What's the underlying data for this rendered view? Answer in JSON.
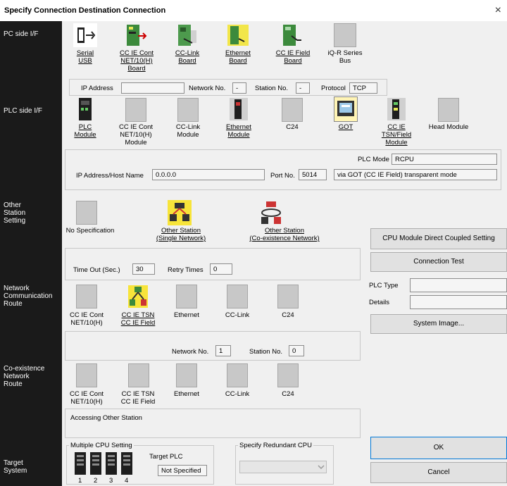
{
  "window": {
    "title": "Specify Connection Destination Connection",
    "close_glyph": "×"
  },
  "left_labels": {
    "pc_side": "PC side I/F",
    "plc_side": "PLC side I/F",
    "other_station": "Other\nStation\nSetting",
    "network_route": "Network\nCommunication\nRoute",
    "coexistence_route": "Co-existence\nNetwork\nRoute",
    "target_system": "Target\nSystem"
  },
  "pc_side": {
    "tiles": [
      {
        "label": "Serial\nUSB",
        "icon": "serial-usb-icon"
      },
      {
        "label": "CC IE Cont\nNET/10(H)\nBoard",
        "icon": "cc-ie-cont-board-icon"
      },
      {
        "label": "CC-Link\nBoard",
        "icon": "cc-link-board-icon"
      },
      {
        "label": "Ethernet\nBoard",
        "icon": "ethernet-board-icon"
      },
      {
        "label": "CC IE Field\nBoard",
        "icon": "cc-ie-field-board-icon"
      },
      {
        "label": "iQ-R Series\nBus",
        "icon": "iq-r-bus-icon"
      }
    ],
    "ip_address_label": "IP Address",
    "ip_address_value": "",
    "network_no_label": "Network No.",
    "network_no_value": "-",
    "station_no_label": "Station No.",
    "station_no_value": "-",
    "protocol_label": "Protocol",
    "protocol_value": "TCP"
  },
  "plc_side": {
    "tiles": [
      {
        "label": "PLC\nModule",
        "icon": "plc-module-icon"
      },
      {
        "label": "CC IE Cont\nNET/10(H)\nModule",
        "icon": "blank-tile-icon"
      },
      {
        "label": "CC-Link\nModule",
        "icon": "blank-tile-icon"
      },
      {
        "label": "Ethernet\nModule",
        "icon": "ethernet-module-icon"
      },
      {
        "label": "C24",
        "icon": "blank-tile-icon"
      },
      {
        "label": "GOT",
        "icon": "got-icon"
      },
      {
        "label": "CC IE\nTSN/Field\nModule",
        "icon": "cc-ie-tsn-module-icon"
      },
      {
        "label": "Head Module",
        "icon": "blank-tile-icon"
      }
    ],
    "plc_mode_label": "PLC Mode",
    "plc_mode_value": "RCPU",
    "ip_host_label": "IP Address/Host Name",
    "ip_host_value": "0.0.0.0",
    "port_label": "Port No.",
    "port_value": "5014",
    "transparent_mode": "via GOT (CC IE Field) transparent mode"
  },
  "other_station": {
    "tiles": [
      {
        "label": "No Specification",
        "icon": "blank-tile-icon"
      },
      {
        "label": "Other Station\n(Single Network)",
        "icon": "single-network-icon"
      },
      {
        "label": "Other Station\n(Co-existence Network)",
        "icon": "coexistence-network-icon"
      }
    ],
    "timeout_label": "Time Out (Sec.)",
    "timeout_value": "30",
    "retry_label": "Retry Times",
    "retry_value": "0"
  },
  "network_route": {
    "tiles": [
      {
        "label": "CC IE Cont\nNET/10(H)",
        "icon": "blank-tile-icon"
      },
      {
        "label": "CC IE TSN\nCC IE Field",
        "icon": "cc-ie-tsn-field-icon"
      },
      {
        "label": "Ethernet",
        "icon": "blank-tile-icon"
      },
      {
        "label": "CC-Link",
        "icon": "blank-tile-icon"
      },
      {
        "label": "C24",
        "icon": "blank-tile-icon"
      }
    ],
    "network_no_label": "Network No.",
    "network_no_value": "1",
    "station_no_label": "Station No.",
    "station_no_value": "0"
  },
  "coexistence_route": {
    "tiles": [
      {
        "label": "CC IE Cont\nNET/10(H)",
        "icon": "blank-tile-icon"
      },
      {
        "label": "CC IE TSN\nCC IE Field",
        "icon": "blank-tile-icon"
      },
      {
        "label": "Ethernet",
        "icon": "blank-tile-icon"
      },
      {
        "label": "CC-Link",
        "icon": "blank-tile-icon"
      },
      {
        "label": "C24",
        "icon": "blank-tile-icon"
      }
    ],
    "accessing_text": "Accessing Other Station"
  },
  "target_system": {
    "multiple_cpu_label": "Multiple CPU Setting",
    "cpu_numbers": [
      "1",
      "2",
      "3",
      "4"
    ],
    "target_plc_label": "Target PLC",
    "target_plc_value": "Not Specified",
    "redundant_label": "Specify Redundant CPU",
    "redundant_value": ""
  },
  "right_panel": {
    "cpu_direct_button": "CPU Module Direct Coupled Setting",
    "connection_test_button": "Connection Test",
    "plc_type_label": "PLC Type",
    "plc_type_value": "",
    "details_label": "Details",
    "details_value": "",
    "system_image_button": "System Image...",
    "ok_button": "OK",
    "cancel_button": "Cancel"
  },
  "colors": {
    "left_column": "#1a1a1a",
    "content_bg": "#f0f0f0",
    "accent": "#0078d7",
    "selected_tile": "#fff4b5"
  }
}
